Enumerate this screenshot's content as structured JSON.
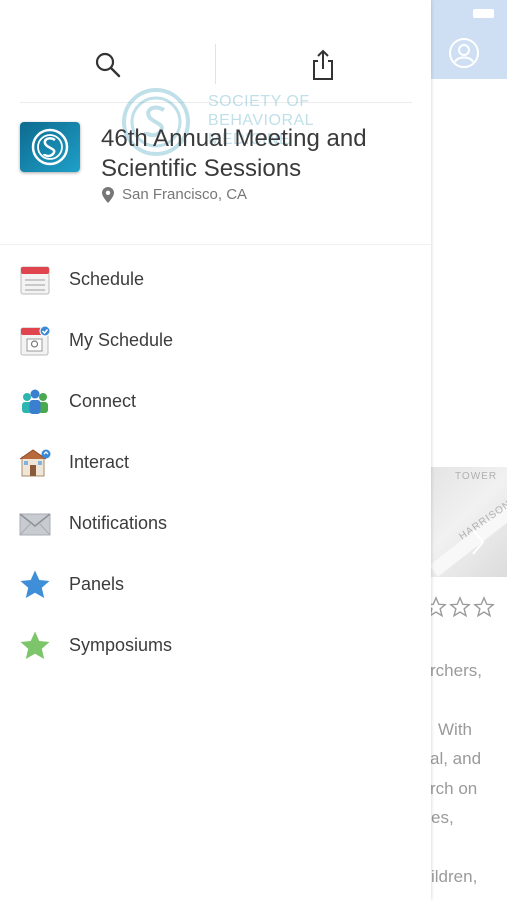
{
  "background": {
    "map_labels": [
      "TOWER",
      "HARRISON"
    ],
    "text_fragments": [
      "rchers,",
      "With",
      "al, and",
      "rch on",
      "es,",
      "ildren,"
    ],
    "accent_color": "#cfdff3"
  },
  "header": {
    "search_icon": "search-icon",
    "share_icon": "share-icon",
    "watermark_text": "SOCIETY OF BEHAVIORAL MEDICINE"
  },
  "event": {
    "title": "46th Annual Meeting and Scientific Sessions",
    "location": "San Francisco, CA",
    "logo_color": "#1c8fb3"
  },
  "menu": {
    "items": [
      {
        "label": "Schedule",
        "icon": "calendar-icon"
      },
      {
        "label": "My Schedule",
        "icon": "my-schedule-icon"
      },
      {
        "label": "Connect",
        "icon": "people-icon"
      },
      {
        "label": "Interact",
        "icon": "interact-icon"
      },
      {
        "label": "Notifications",
        "icon": "envelope-icon"
      },
      {
        "label": "Panels",
        "icon": "blue-star-icon"
      },
      {
        "label": "Symposiums",
        "icon": "green-star-icon"
      }
    ]
  }
}
